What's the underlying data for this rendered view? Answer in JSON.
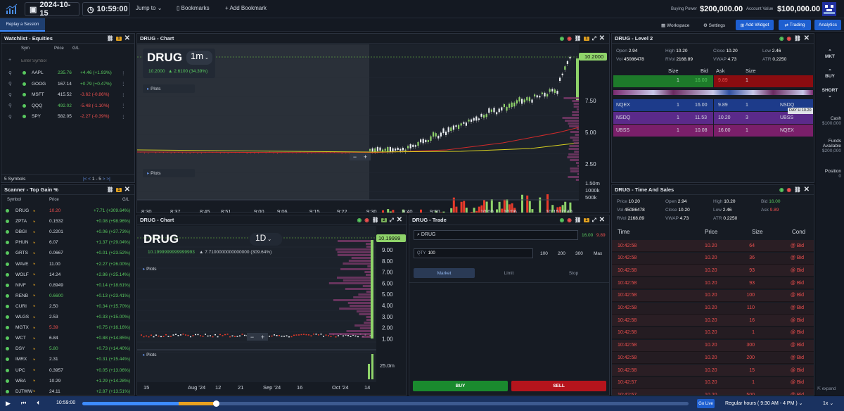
{
  "topbar": {
    "date": "2024-10-15",
    "time": "10:59:00",
    "jump": "Jump to",
    "bookmarks": "Bookmarks",
    "add_bookmark": "Add Bookmark",
    "buying_power_label": "Buying Power",
    "buying_power": "$200,000.00",
    "account_value_label": "Account Value",
    "account_value": "$100,000.00"
  },
  "subbar": {
    "replay": "Replay a Session",
    "workspace": "Workspace",
    "settings": "Settings",
    "add_widget": "Add Widget",
    "trading": "Trading",
    "analytics": "Analytics"
  },
  "watchlist": {
    "title": "Watchlist - Equities",
    "badge": "1",
    "cols": [
      "Sym",
      "Price",
      "G/L"
    ],
    "placeholder": "Enter Symbol",
    "rows": [
      {
        "sym": "AAPL",
        "price": "235.76",
        "gl": "+4.46 (+1.93%)",
        "pc": "g",
        "gc": "g"
      },
      {
        "sym": "GOOG",
        "price": "167.14",
        "gl": "+0.79 (+0.47%)",
        "pc": "w",
        "gc": "g"
      },
      {
        "sym": "MSFT",
        "price": "415.52",
        "gl": "-3.62 (-0.86%)",
        "pc": "w",
        "gc": "r"
      },
      {
        "sym": "QQQ",
        "price": "492.02",
        "gl": "-5.48 (-1.10%)",
        "pc": "g",
        "gc": "r"
      },
      {
        "sym": "SPY",
        "price": "582.05",
        "gl": "-2.27 (-0.39%)",
        "pc": "w",
        "gc": "r"
      }
    ],
    "footer": "5 Symbols",
    "page": "1 - 5"
  },
  "scanner": {
    "title": "Scanner - Top Gain %",
    "badge": "1",
    "cols": [
      "Symbol",
      "Price",
      "G/L"
    ],
    "rows": [
      {
        "sym": "DRUG",
        "price": "10.20",
        "gl": "+7.71 (+309.64%)",
        "pc": "r"
      },
      {
        "sym": "ZPTA",
        "price": "0.1532",
        "gl": "+0.08 (+98.96%)",
        "pc": "w"
      },
      {
        "sym": "DBGI",
        "price": "0.2201",
        "gl": "+0.06 (+37.73%)",
        "pc": "w"
      },
      {
        "sym": "PHUN",
        "price": "6.07",
        "gl": "+1.37 (+29.04%)",
        "pc": "w"
      },
      {
        "sym": "GRTS",
        "price": "0.0667",
        "gl": "+0.01 (+23.52%)",
        "pc": "w"
      },
      {
        "sym": "WAVE",
        "price": "11.00",
        "gl": "+2.27 (+26.00%)",
        "pc": "w"
      },
      {
        "sym": "WOLF",
        "price": "14.24",
        "gl": "+2.86 (+25.14%)",
        "pc": "w"
      },
      {
        "sym": "NIVF",
        "price": "0.8949",
        "gl": "+0.14 (+18.61%)",
        "pc": "w"
      },
      {
        "sym": "RENB",
        "price": "0.6600",
        "gl": "+0.13 (+23.41%)",
        "pc": "g"
      },
      {
        "sym": "CURI",
        "price": "2.50",
        "gl": "+0.34 (+15.70%)",
        "pc": "w"
      },
      {
        "sym": "WLGS",
        "price": "2.53",
        "gl": "+0.33 (+15.00%)",
        "pc": "w"
      },
      {
        "sym": "MGTX",
        "price": "5.39",
        "gl": "+0.75 (+16.16%)",
        "pc": "r"
      },
      {
        "sym": "WCT",
        "price": "6.84",
        "gl": "+0.88 (+14.85%)",
        "pc": "w"
      },
      {
        "sym": "DSY",
        "price": "5.80",
        "gl": "+0.73 (+14.40%)",
        "pc": "g"
      },
      {
        "sym": "IMRX",
        "price": "2.31",
        "gl": "+0.31 (+15.44%)",
        "pc": "w"
      },
      {
        "sym": "UPC",
        "price": "0.3957",
        "gl": "+0.05 (+13.06%)",
        "pc": "w"
      },
      {
        "sym": "WBA",
        "price": "10.29",
        "gl": "+1.29 (+14.28%)",
        "pc": "w"
      },
      {
        "sym": "DJTWW",
        "price": "24.11",
        "gl": "+2.87 (+13.51%)",
        "pc": "w"
      }
    ]
  },
  "chart1": {
    "title": "DRUG - Chart",
    "badge": "1",
    "symbol": "DRUG",
    "interval": "1m",
    "price": "10.2000",
    "change": "2.6100 (34.39%)",
    "plots": "Plots",
    "last_tag": "10.2000",
    "y_ticks": [
      "7.50",
      "5.00",
      "2.50"
    ],
    "vol_ticks": [
      "1.50m",
      "1000k",
      "500k"
    ],
    "x_ticks": [
      "8:30",
      "8:37",
      "8:45",
      "8:51",
      "9:00",
      "9:06",
      "9:15",
      "9:22",
      "9:30",
      "9:40",
      "9:50",
      "10:00",
      "10:06",
      "10:15",
      "10:30"
    ]
  },
  "chart2": {
    "title": "DRUG - Chart",
    "badge": "2",
    "symbol": "DRUG",
    "interval": "1D",
    "price": "10.1999999999999993",
    "change": "7.7100000000000000 (309.64%)",
    "plots": "Plots",
    "last_tag": "10.19999",
    "y_ticks": [
      "9.00",
      "8.00",
      "7.00",
      "6.00",
      "5.00",
      "4.00",
      "3.00",
      "2.00",
      "1.00"
    ],
    "vol_tick": "25.0m",
    "x_ticks": [
      "15",
      "Aug '24",
      "12",
      "21",
      "Sep '24",
      "16",
      "Oct '24",
      "14"
    ]
  },
  "trade": {
    "title": "DRUG - Trade",
    "symbol": "DRUG",
    "bid": "16.00",
    "ask": "9.89",
    "qty_label": "QTY",
    "qty": "100",
    "presets": [
      "100",
      "200",
      "300",
      "Max"
    ],
    "tabs": [
      "Market",
      "Limit",
      "Stop"
    ],
    "buy": "BUY",
    "sell": "SELL"
  },
  "level2": {
    "title": "DRUG - Level 2",
    "stats": [
      [
        "Open",
        "2.94"
      ],
      [
        "High",
        "10.20"
      ],
      [
        "Close",
        "10.20"
      ],
      [
        "Low",
        "2.46"
      ],
      [
        "Vol",
        "45086478"
      ],
      [
        "RVol",
        "2168.89"
      ],
      [
        "VWAP",
        "4.73"
      ],
      [
        "ATR",
        "0.2250"
      ]
    ],
    "heads": [
      "Size",
      "Bid",
      "Ask",
      "Size"
    ],
    "top_bid": [
      "1",
      "16.00"
    ],
    "top_ask": [
      "9.89",
      "1"
    ],
    "bids": [
      [
        "NQEX",
        "1",
        "16.00"
      ],
      [
        "NSDQ",
        "1",
        "11.53"
      ],
      [
        "UBSS",
        "1",
        "10.08"
      ]
    ],
    "asks": [
      [
        "9.89",
        "1",
        "NSDQ"
      ],
      [
        "10.20",
        "3",
        "UBSS"
      ],
      [
        "16.00",
        "1",
        "NQEX"
      ]
    ],
    "tooltip": "DAY H 10.20"
  },
  "tas": {
    "title": "DRUG - Time And Sales",
    "stats": [
      [
        "Price",
        "10.20"
      ],
      [
        "Open",
        "2.94"
      ],
      [
        "High",
        "10.20"
      ],
      [
        "Bid",
        "16.00"
      ],
      [
        "Vol",
        "45086478"
      ],
      [
        "Close",
        "10.20"
      ],
      [
        "Low",
        "2.46"
      ],
      [
        "Ask",
        "9.89"
      ],
      [
        "RVol",
        "2168.89"
      ],
      [
        "VWAP",
        "4.73"
      ],
      [
        "ATR",
        "0.2250"
      ]
    ],
    "cols": [
      "Time",
      "Price",
      "Size",
      "Cond"
    ],
    "rows": [
      [
        "10:42:58",
        "10.20",
        "64",
        "@ Bid"
      ],
      [
        "10:42:58",
        "10.20",
        "36",
        "@ Bid"
      ],
      [
        "10:42:58",
        "10.20",
        "93",
        "@ Bid"
      ],
      [
        "10:42:58",
        "10.20",
        "93",
        "@ Bid"
      ],
      [
        "10:42:58",
        "10.20",
        "100",
        "@ Bid"
      ],
      [
        "10:42:58",
        "10.20",
        "110",
        "@ Bid"
      ],
      [
        "10:42:58",
        "10.20",
        "16",
        "@ Bid"
      ],
      [
        "10:42:58",
        "10.20",
        "1",
        "@ Bid"
      ],
      [
        "10:42:58",
        "10.20",
        "300",
        "@ Bid"
      ],
      [
        "10:42:58",
        "10.20",
        "200",
        "@ Bid"
      ],
      [
        "10:42:58",
        "10.20",
        "15",
        "@ Bid"
      ],
      [
        "10:42:57",
        "10.20",
        "1",
        "@ Bid"
      ],
      [
        "10:42:57",
        "10.20",
        "500",
        "@ Bid"
      ]
    ]
  },
  "rightbar": {
    "mkt": "MKT",
    "buy": "BUY",
    "short": "SHORT",
    "cash_label": "Cash",
    "cash": "$100,000",
    "funds_label": "Funds Available",
    "funds": "$200,000",
    "position_label": "Position",
    "position": "0",
    "expand": "expand"
  },
  "bottombar": {
    "time": "10:59:00",
    "progress": 0.22,
    "go_live": "Go Live",
    "session": "Regular hours ( 9:30 AM - 4 PM )",
    "speed": "1x"
  }
}
